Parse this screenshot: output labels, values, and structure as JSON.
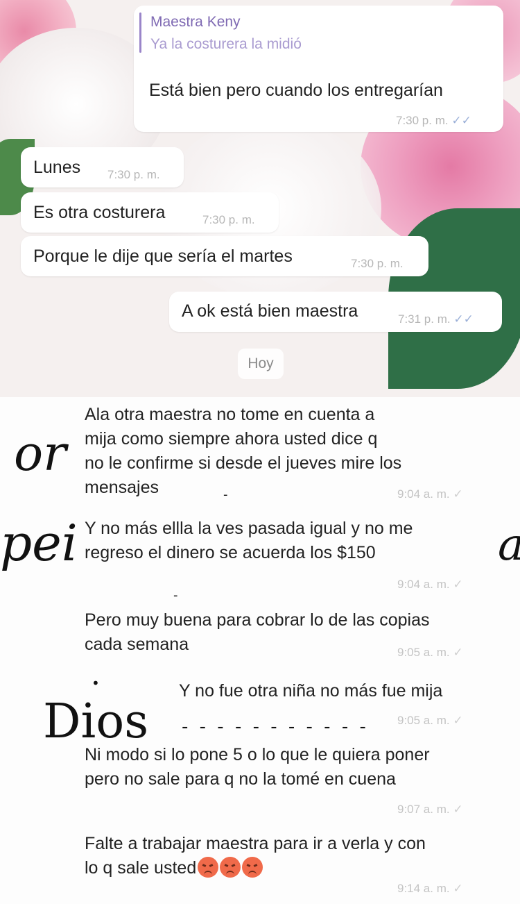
{
  "chat": {
    "quoted": {
      "name": "Maestra Keny",
      "text": "Ya la costurera la midió",
      "reply": "Está bien pero cuando los entregarían",
      "time": "7:30 p. m.",
      "ticks": "✓✓"
    },
    "incoming": [
      {
        "text": "Lunes",
        "time": "7:30 p. m."
      },
      {
        "text": "Es otra costurera",
        "time": "7:30 p. m."
      },
      {
        "text": "Porque le dije que sería el martes",
        "time": "7:30 p. m."
      }
    ],
    "outgoing": {
      "text": "A ok está bien maestra",
      "time": "7:31 p. m.",
      "ticks": "✓✓"
    },
    "day_label": "Hoy",
    "today_messages": [
      {
        "lines": [
          "Ala otra maestra no tome en cuenta a",
          "mija como siempre ahora usted dice q",
          "no le confirme si desde el jueves mire los",
          "mensajes"
        ],
        "time": "9:04 a. m.",
        "tick": "✓"
      },
      {
        "lines": [
          "Y no más ellla la ves pasada igual y no me",
          "regreso el dinero se acuerda los $150"
        ],
        "time": "9:04 a. m.",
        "tick": "✓"
      },
      {
        "lines": [
          "Pero muy buena para cobrar lo de las copias",
          "cada semana"
        ],
        "time": "9:05 a. m.",
        "tick": "✓"
      },
      {
        "lines": [
          "Y no fue otra niña no más fue mija"
        ],
        "time": "9:05 a. m.",
        "tick": "✓"
      },
      {
        "lines": [
          "Ni modo si lo pone 5 o lo que le quiera poner",
          "pero no sale para q no la tomé en cuena"
        ],
        "time": "9:07 a. m.",
        "tick": "✓"
      },
      {
        "lines": [
          "Falte a trabajar maestra para ir a verla y con",
          "lo q sale usted"
        ],
        "time": "9:14 a. m.",
        "tick": "✓",
        "emoji": "pouting-face-icon"
      }
    ]
  },
  "background_text": {
    "word1": "or",
    "word2": "pei",
    "word3": "a",
    "word4": "Dios",
    "dashes": "- - - - - - - - - - -"
  },
  "colors": {
    "accent_quote": "#9a85c9",
    "read_ticks": "#9bb0d8",
    "bubble": "#ffffff"
  }
}
